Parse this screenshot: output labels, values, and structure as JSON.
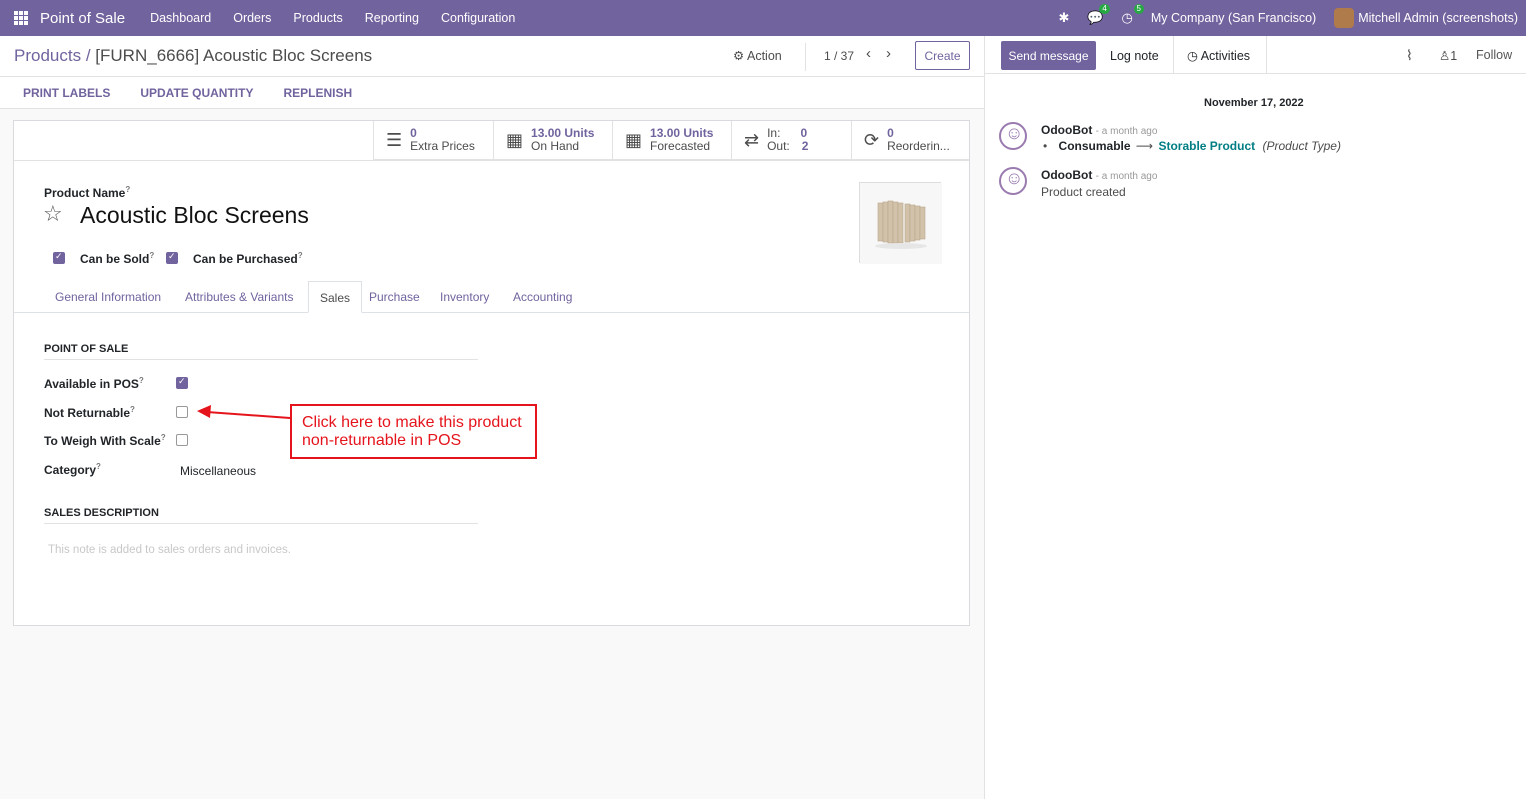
{
  "topbar": {
    "app_name": "Point of Sale",
    "menus": [
      "Dashboard",
      "Orders",
      "Products",
      "Reporting",
      "Configuration"
    ],
    "messages_count": "4",
    "activities_count": "5",
    "company": "My Company (San Francisco)",
    "user": "Mitchell Admin (screenshots)"
  },
  "control_panel": {
    "breadcrumb_parent": "Products",
    "breadcrumb_sep": "/",
    "breadcrumb_current": "[FURN_6666] Acoustic Bloc Screens",
    "action_label": "Action",
    "pager": "1 / 37",
    "create_label": "Create",
    "status_buttons": [
      "PRINT LABELS",
      "UPDATE QUANTITY",
      "REPLENISH"
    ]
  },
  "smart_buttons": [
    {
      "value": "0",
      "label": "Extra Prices"
    },
    {
      "value": "13.00 Units",
      "label": "On Hand"
    },
    {
      "value": "13.00 Units",
      "label": "Forecasted"
    },
    {
      "in_label": "In:",
      "in_value": "0",
      "out_label": "Out:",
      "out_value": "2"
    },
    {
      "value": "0",
      "label": "Reorderin..."
    }
  ],
  "product": {
    "name_label": "Product Name",
    "name": "Acoustic Bloc Screens",
    "can_be_sold_label": "Can be Sold",
    "can_be_sold": true,
    "can_be_purchased_label": "Can be Purchased",
    "can_be_purchased": true
  },
  "tabs": [
    "General Information",
    "Attributes & Variants",
    "Sales",
    "Purchase",
    "Inventory",
    "Accounting"
  ],
  "active_tab": "Sales",
  "pos_section": {
    "title": "POINT OF SALE",
    "available_in_pos_label": "Available in POS",
    "available_in_pos": true,
    "not_returnable_label": "Not Returnable",
    "not_returnable": false,
    "to_weigh_label": "To Weigh With Scale",
    "to_weigh": false,
    "category_label": "Category",
    "category": "Miscellaneous"
  },
  "sales_description": {
    "title": "SALES DESCRIPTION",
    "placeholder": "This note is added to sales orders and invoices."
  },
  "callout": {
    "line1": "Click here to make this product",
    "line2": "non-returnable in POS",
    "color": "#e5141c"
  },
  "chatter": {
    "send_message": "Send message",
    "log_note": "Log note",
    "activities": "Activities",
    "followers_count": "1",
    "follow": "Follow",
    "date": "November 17, 2022",
    "messages": [
      {
        "author": "OdooBot",
        "time": "- a month ago",
        "old_value": "Consumable",
        "new_value": "Storable Product",
        "field": "(Product Type)"
      },
      {
        "author": "OdooBot",
        "time": "- a month ago",
        "body": "Product created"
      }
    ]
  },
  "colors": {
    "brand": "#71639e",
    "topbar": "#71639e"
  }
}
